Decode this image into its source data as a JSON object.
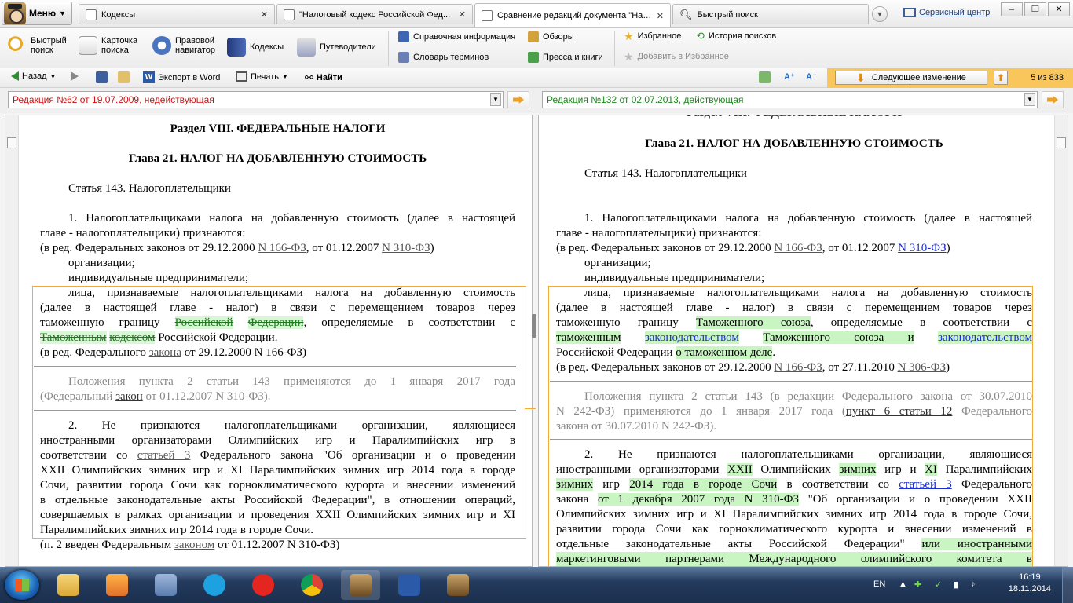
{
  "app": {
    "menu_label": "Меню"
  },
  "tabs": [
    {
      "label": "Кодексы"
    },
    {
      "label": "\"Налоговый кодекс Российской Фед..."
    },
    {
      "label": "Сравнение редакций документа \"Нал..."
    },
    {
      "label": "Быстрый поиск"
    }
  ],
  "service_center": "Сервисный центр",
  "ribbon": {
    "quick_search_1": "Быстрый",
    "quick_search_2": "поиск",
    "card_search_1": "Карточка",
    "card_search_2": "поиска",
    "legal_nav_1": "Правовой",
    "legal_nav_2": "навигатор",
    "codes": "Кодексы",
    "guides": "Путеводители",
    "reference": "Справочная информация",
    "reviews": "Обзоры",
    "glossary": "Словарь терминов",
    "press": "Пресса и книги",
    "favorites": "Избранное",
    "search_history": "История поисков",
    "add_favorites": "Добавить в Избранное"
  },
  "toolbar": {
    "back": "Назад",
    "export_word": "Экспорт в Word",
    "print": "Печать",
    "find": "Найти",
    "next_change": "Следующее изменение",
    "counter": "5 из 833"
  },
  "editions": {
    "left": "Редакция №62 от 19.07.2009, недействующая",
    "right": "Редакция №132 от 02.07.2013, действующая",
    "left_color": "#d01010",
    "right_color": "#1a8a1a"
  },
  "left": {
    "section": "Раздел VIII. ФЕДЕРАЛЬНЫЕ НАЛОГИ",
    "chapter": "Глава 21. НАЛОГ НА ДОБАВЛЕННУЮ СТОИМОСТЬ",
    "article": "Статья 143. Налогоплательщики",
    "p1a": "1. Налогоплательщиками налога на добавленную стоимость (далее в настоящей",
    "p1b": "главе - налогоплательщики) признаются:",
    "ed1_pre": "(в ред. Федеральных законов от 29.12.2000 ",
    "ed1_l1": "N 166-ФЗ",
    "ed1_mid": ", от 01.12.2007 ",
    "ed1_l2": "N 310-ФЗ",
    "ed1_post": ")",
    "org": "организации;",
    "ip": "индивидуальные предприниматели;",
    "l1": "лица, признаваемые налогоплательщиками налога на добавленную стоимость",
    "l2": "(далее в настоящей главе - налог) в связи с перемещением товаров через",
    "l3_pre": "таможенную границу ",
    "l3_del1": "Российской",
    "l3_del2": "Федерации",
    "l3_post": ", определяемые в соответствии с",
    "l4_del1": "Таможенным",
    "l4_del2": "кодексом",
    "l4_post": " Российской Федерации.",
    "ed2_pre": "(в ред. Федерального ",
    "ed2_link": "закона",
    "ed2_post": " от 29.12.2000 N 166-ФЗ)",
    "note1": "Положения пункта 2 статьи 143 применяются до 1 января 2017 года",
    "note2_pre": "(Федеральный ",
    "note2_link": "закон",
    "note2_post": " от 01.12.2007 N 310-ФЗ).",
    "p2a": "2. Не признаются налогоплательщиками организации, являющиеся",
    "p2b": "иностранными организаторами Олимпийских игр и Паралимпийских игр в",
    "p2c_pre": "соответствии со ",
    "p2c_link": "статьей 3",
    "p2c_post": " Федерального закона \"Об организации и о проведении",
    "p2d": "XXII Олимпийских зимних игр и XI Паралимпийских зимних игр 2014 года в городе",
    "p2e": "Сочи, развитии города Сочи как горноклиматического курорта и внесении изменений",
    "p2f": "в отдельные законодательные акты Российской Федерации\", в отношении операций,",
    "p2g": "совершаемых в рамках организации и проведения XXII Олимпийских зимних игр и XI",
    "p2h": "Паралимпийских зимних игр 2014 года в городе Сочи.",
    "intro_pre": "(п. 2 введен Федеральным ",
    "intro_link": "законом",
    "intro_post": " от 01.12.2007 N 310-ФЗ)"
  },
  "right": {
    "section_cut": "Раздел VIII. ФЕДЕРАЛЬНЫЕ НАЛОГИ",
    "chapter": "Глава 21. НАЛОГ НА ДОБАВЛЕННУЮ СТОИМОСТЬ",
    "article": "Статья 143. Налогоплательщики",
    "p1a": "1. Налогоплательщиками налога на добавленную стоимость (далее в настоящей",
    "p1b": "главе - налогоплательщики) признаются:",
    "ed1_pre": "(в ред. Федеральных законов от 29.12.2000 ",
    "ed1_l1": "N 166-ФЗ",
    "ed1_mid": ", от 01.12.2007 ",
    "ed1_l2": "N 310-ФЗ",
    "ed1_post": ")",
    "org": "организации;",
    "ip": "индивидуальные предприниматели;",
    "l1": "лица, признаваемые налогоплательщиками налога на добавленную стоимость",
    "l2": "(далее в настоящей главе - налог) в связи с перемещением товаров через",
    "l3_pre": "таможенную границу ",
    "l3_hl": "Таможенного союза",
    "l3_post": ", определяемые в соответствии с",
    "l4_hl1": "таможенным",
    "l4_link1": "законодательством",
    "l4_hl2": "Таможенного союза и",
    "l4_link2": "законодательством",
    "l5_pre": "Российской Федерации ",
    "l5_hl": "о таможенном деле",
    "l5_post": ".",
    "ed2_pre": "(в ред. Федеральных законов от 29.12.2000 ",
    "ed2_l1": "N 166-ФЗ",
    "ed2_mid": ", от 27.11.2010 ",
    "ed2_l2": "N 306-ФЗ",
    "ed2_post": ")",
    "note1": "Положения пункта 2 статьи 143 (в редакции Федерального закона от 30.07.2010",
    "note2_pre": "N 242-ФЗ) применяются до 1 января 2017 года (",
    "note2_link": "пункт 6 статьи 12",
    "note2_post": " Федерального",
    "note3": "закона от 30.07.2010 N 242-ФЗ).",
    "p2a": "2. Не признаются налогоплательщиками организации, являющиеся",
    "p2b_pre": "иностранными организаторами ",
    "p2b_hl1": "XXII",
    "p2b_mid1": " Олимпийских ",
    "p2b_hl2": "зимних",
    "p2b_mid2": " игр и ",
    "p2b_hl3": "XI",
    "p2b_post": " Паралимпийских",
    "p2c_hl1": "зимних",
    "p2c_mid": " игр ",
    "p2c_hl2": "2014 года в городе Сочи",
    "p2c_mid2": " в соответствии со ",
    "p2c_link": "статьей 3",
    "p2c_post": " Федерального",
    "p2d_pre": "закона ",
    "p2d_hl": "от 1 декабря 2007 года N 310-ФЗ",
    "p2d_post": " \"Об организации и о проведении XXII",
    "p2e": "Олимпийских зимних игр и XI Паралимпийских зимних игр 2014 года в городе Сочи,",
    "p2f": "развитии города Сочи как горноклиматического курорта и внесении изменений в",
    "p2g_pre": "отдельные законодательные акты Российской Федерации\" ",
    "p2g_hl": "или иностранными",
    "p2h": "маркетинговыми партнерами Международного олимпийского комитета в"
  },
  "taskbar": {
    "lang": "EN",
    "time": "16:19",
    "date": "18.11.2014"
  }
}
